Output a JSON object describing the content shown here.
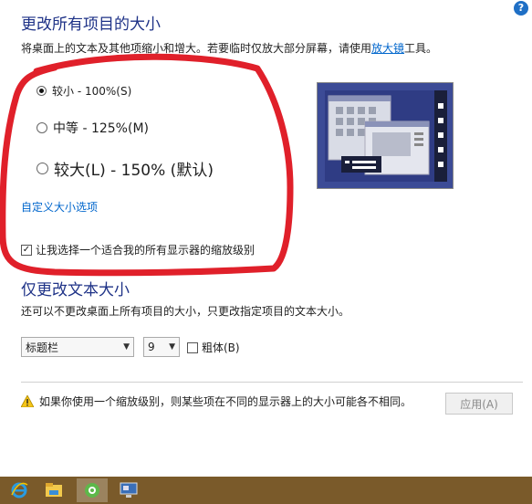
{
  "header": {
    "title": "更改所有项目的大小",
    "desc_before": "将桌面上的文本及其他项缩小和增大。若要临时仅放大部分屏幕，请使用",
    "desc_link": "放大镜",
    "desc_after": "工具。",
    "help": "?"
  },
  "size_options": [
    {
      "label": "较小 - 100%(S)",
      "selected": true
    },
    {
      "label": "中等 - 125%(M)",
      "selected": false
    },
    {
      "label": "较大(L) - 150% (默认)",
      "selected": false
    }
  ],
  "custom_link": "自定义大小选项",
  "scale_checkbox": {
    "label": "让我选择一个适合我的所有显示器的缩放级别",
    "checked": true
  },
  "text_section": {
    "title": "仅更改文本大小",
    "desc": "还可以不更改桌面上所有项目的大小，只更改指定项目的文本大小。",
    "element_select": "标题栏",
    "size_select": "9",
    "bold_label": "粗体(B)"
  },
  "warning": "如果你使用一个缩放级别，则某些项在不同的显示器上的大小可能各不相同。",
  "apply_button": "应用(A)",
  "colors": {
    "accent": "#1e3287",
    "link": "#0066cc",
    "annotation": "#e0202a",
    "taskbar": "#7a5a2a"
  },
  "taskbar_icons": [
    "ie-icon",
    "file-explorer-icon",
    "browser-icon",
    "display-settings-icon"
  ]
}
